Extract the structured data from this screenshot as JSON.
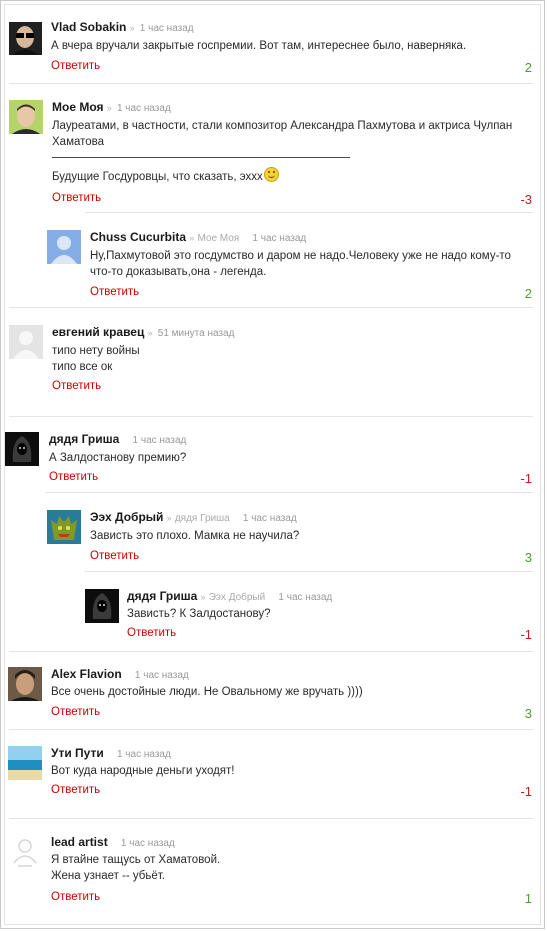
{
  "reply_label": "Ответить",
  "colors": {
    "reply": "#cc0000",
    "score_positive": "#4aa12c",
    "score_negative": "#cc1a1a"
  },
  "comments": [
    {
      "author": "Vlad Sobakin",
      "reply_to": "",
      "time": "1 час назад",
      "lines": [
        "А вчера вручали закрытые госпремии. Вот там, интереснее было, наверняка."
      ],
      "score": "2",
      "avatar": "dark-glasses-avatar"
    },
    {
      "author": "Мое Моя",
      "reply_to": "",
      "time": "1 час назад",
      "lines": [
        "Лауреатами, в частности, стали композитор Александра Пахмутова и актриса Чулпан",
        "Хаматова"
      ],
      "extra_line": "Будущие Госдуровцы, что сказать, эххх",
      "score": "-3",
      "avatar": "man-photo-avatar"
    },
    {
      "author": "Chuss Cucurbita",
      "reply_to": "Мое Моя",
      "time": "1 час назад",
      "lines": [
        "Ну,Пахмутовой это госдумство и даром не надо.Человеку уже не надо кому-то",
        "что-то доказывать,она - легенда."
      ],
      "score": "2",
      "avatar": "default-blue-avatar"
    },
    {
      "author": "евгений кравец",
      "reply_to": "",
      "time": "51 минута назад",
      "lines": [
        "типо нету войны",
        "типо все ок"
      ],
      "score": "",
      "avatar": "default-grey-avatar"
    },
    {
      "author": "дядя Гриша",
      "reply_to": "",
      "time": "1 час назад",
      "lines": [
        "А Залдостанову премию?"
      ],
      "score": "-1",
      "avatar": "hooded-figure-avatar"
    },
    {
      "author": "Ээх Добрый",
      "reply_to": "дядя Гриша",
      "time": "1 час назад",
      "lines": [
        "Зависть это плохо. Мамка не научила?"
      ],
      "score": "3",
      "avatar": "goblin-avatar"
    },
    {
      "author": "дядя Гриша",
      "reply_to": "Ээх Добрый",
      "time": "1 час назад",
      "lines": [
        "Зависть? К Залдостанову?"
      ],
      "score": "-1",
      "avatar": "hooded-figure-avatar"
    },
    {
      "author": "Alex Flavion",
      "reply_to": "",
      "time": "1 час назад",
      "lines": [
        "Все очень достойные люди. Не Овальному же вручать ))))"
      ],
      "score": "3",
      "avatar": "man-portrait-avatar"
    },
    {
      "author": "Ути Пути",
      "reply_to": "",
      "time": "1 час назад",
      "lines": [
        "Вот куда народные деньги уходят!"
      ],
      "score": "-1",
      "avatar": "beach-avatar"
    },
    {
      "author": "lead artist",
      "reply_to": "",
      "time": "1 час назад",
      "lines": [
        "Я втайне тащусь от Хаматовой.",
        "Жена узнает -- убьёт."
      ],
      "score": "1",
      "avatar": "no-photo-avatar"
    }
  ]
}
